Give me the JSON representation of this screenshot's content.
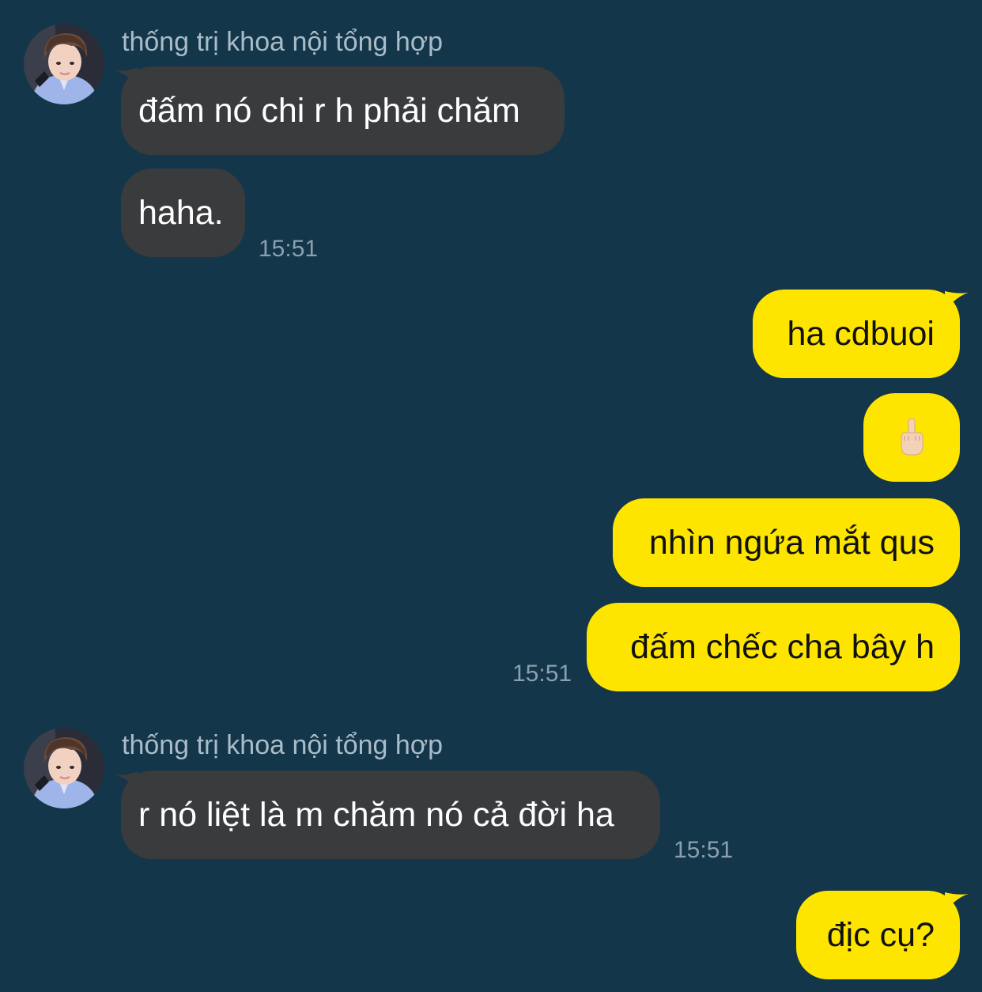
{
  "colors": {
    "background": "#13364a",
    "incoming_bubble": "#3a3b3d",
    "outgoing_bubble": "#fee500",
    "sender_name": "#a9bcc8",
    "timestamp": "#8aa0ae"
  },
  "groups": [
    {
      "direction": "incoming",
      "sender": "thống trị khoa nội tổng hợp",
      "avatar_icon": "profile-photo",
      "messages": [
        "đấm nó chi r h phải chăm",
        "haha."
      ],
      "time": "15:51"
    },
    {
      "direction": "outgoing",
      "messages": [
        "ha cdbuoi",
        "middle-finger-emoji",
        "nhìn ngứa mắt qus",
        "đấm chếc cha bây h"
      ],
      "time": "15:51"
    },
    {
      "direction": "incoming",
      "sender": "thống trị khoa nội tổng hợp",
      "avatar_icon": "profile-photo",
      "messages": [
        "r nó liệt là m chăm nó cả đời ha"
      ],
      "time": "15:51"
    },
    {
      "direction": "outgoing",
      "messages": [
        "địc cụ?"
      ]
    }
  ]
}
